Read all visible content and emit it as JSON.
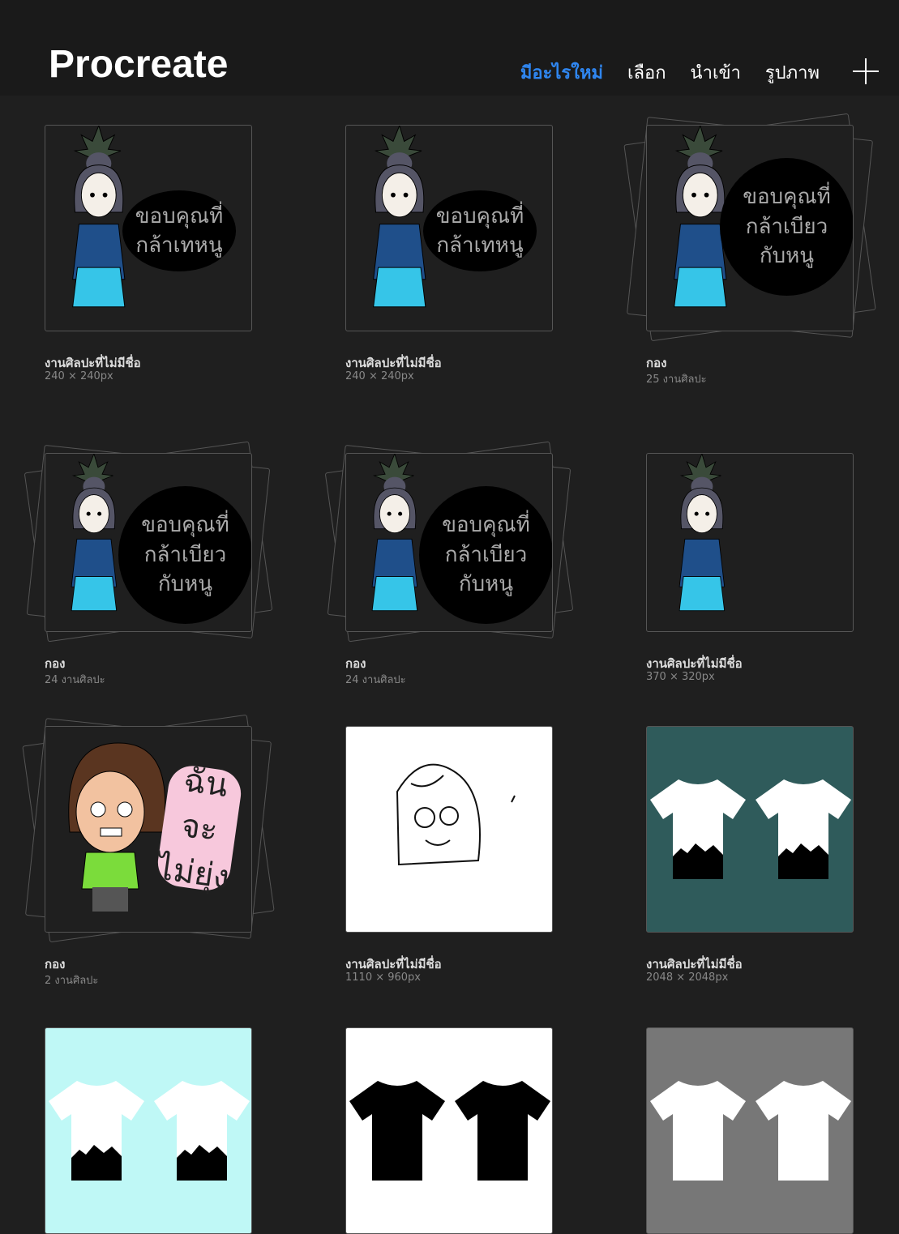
{
  "header": {
    "app_title": "Procreate",
    "nav": [
      {
        "label": "มีอะไรใหม่",
        "active": true
      },
      {
        "label": "เลือก"
      },
      {
        "label": "นำเข้า"
      },
      {
        "label": "รูปภาพ"
      }
    ],
    "add_icon": "plus-icon",
    "accent": "#2f86f0"
  },
  "gallery": [
    {
      "kind": "artwork",
      "title": "งานศิลปะที่ไม่มีชื่อ",
      "sub": "240 × 240px",
      "art": "girl-bubble",
      "bubble": "ขอบคุณที่\nกล้าเทหนู",
      "bg": "#1f1f1f"
    },
    {
      "kind": "artwork",
      "title": "งานศิลปะที่ไม่มีชื่อ",
      "sub": "240 × 240px",
      "art": "girl-bubble",
      "bubble": "ขอบคุณที่\nกล้าเทหนู",
      "bg": "#1f1f1f"
    },
    {
      "kind": "stack",
      "title": "กอง",
      "sub": "25 งานศิลปะ",
      "art": "girl-bubble",
      "bubble": "ขอบคุณที่\nกล้าเบียว\nกับหนู",
      "bg": "#1f1f1f"
    },
    {
      "kind": "stack",
      "title": "กอง",
      "sub": "24 งานศิลปะ",
      "art": "girl-bubble",
      "bubble": "ขอบคุณที่\nกล้าเบียว\nกับหนู",
      "bg": "#1f1f1f"
    },
    {
      "kind": "stack",
      "title": "กอง",
      "sub": "24 งานศิลปะ",
      "art": "girl-bubble",
      "bubble": "ขอบคุณที่\nกล้าเบียว\nกับหนู",
      "bg": "#1f1f1f"
    },
    {
      "kind": "artwork",
      "title": "งานศิลปะที่ไม่มีชื่อ",
      "sub": "370 × 320px",
      "art": "girl",
      "bg": "#1f1f1f"
    },
    {
      "kind": "stack",
      "title": "กอง",
      "sub": "2 งานศิลปะ",
      "art": "angry-girl",
      "bubble": "ฉันจะ\nไม่ยุ่ง",
      "bg": "#1f1f1f"
    },
    {
      "kind": "artwork",
      "title": "งานศิลปะที่ไม่มีชื่อ",
      "sub": "1110 × 960px",
      "art": "face-sketch",
      "bg": "#ffffff"
    },
    {
      "kind": "artwork",
      "title": "งานศิลปะที่ไม่มีชื่อ",
      "sub": "2048 × 2048px",
      "art": "tshirts-white",
      "bg": "#2f5b5b"
    },
    {
      "kind": "artwork",
      "art": "tshirts-white",
      "bg": "#bff8f6"
    },
    {
      "kind": "artwork",
      "art": "tshirts-black",
      "bg": "#ffffff"
    },
    {
      "kind": "artwork",
      "art": "tshirts-white-plain",
      "bg": "#777777"
    }
  ]
}
